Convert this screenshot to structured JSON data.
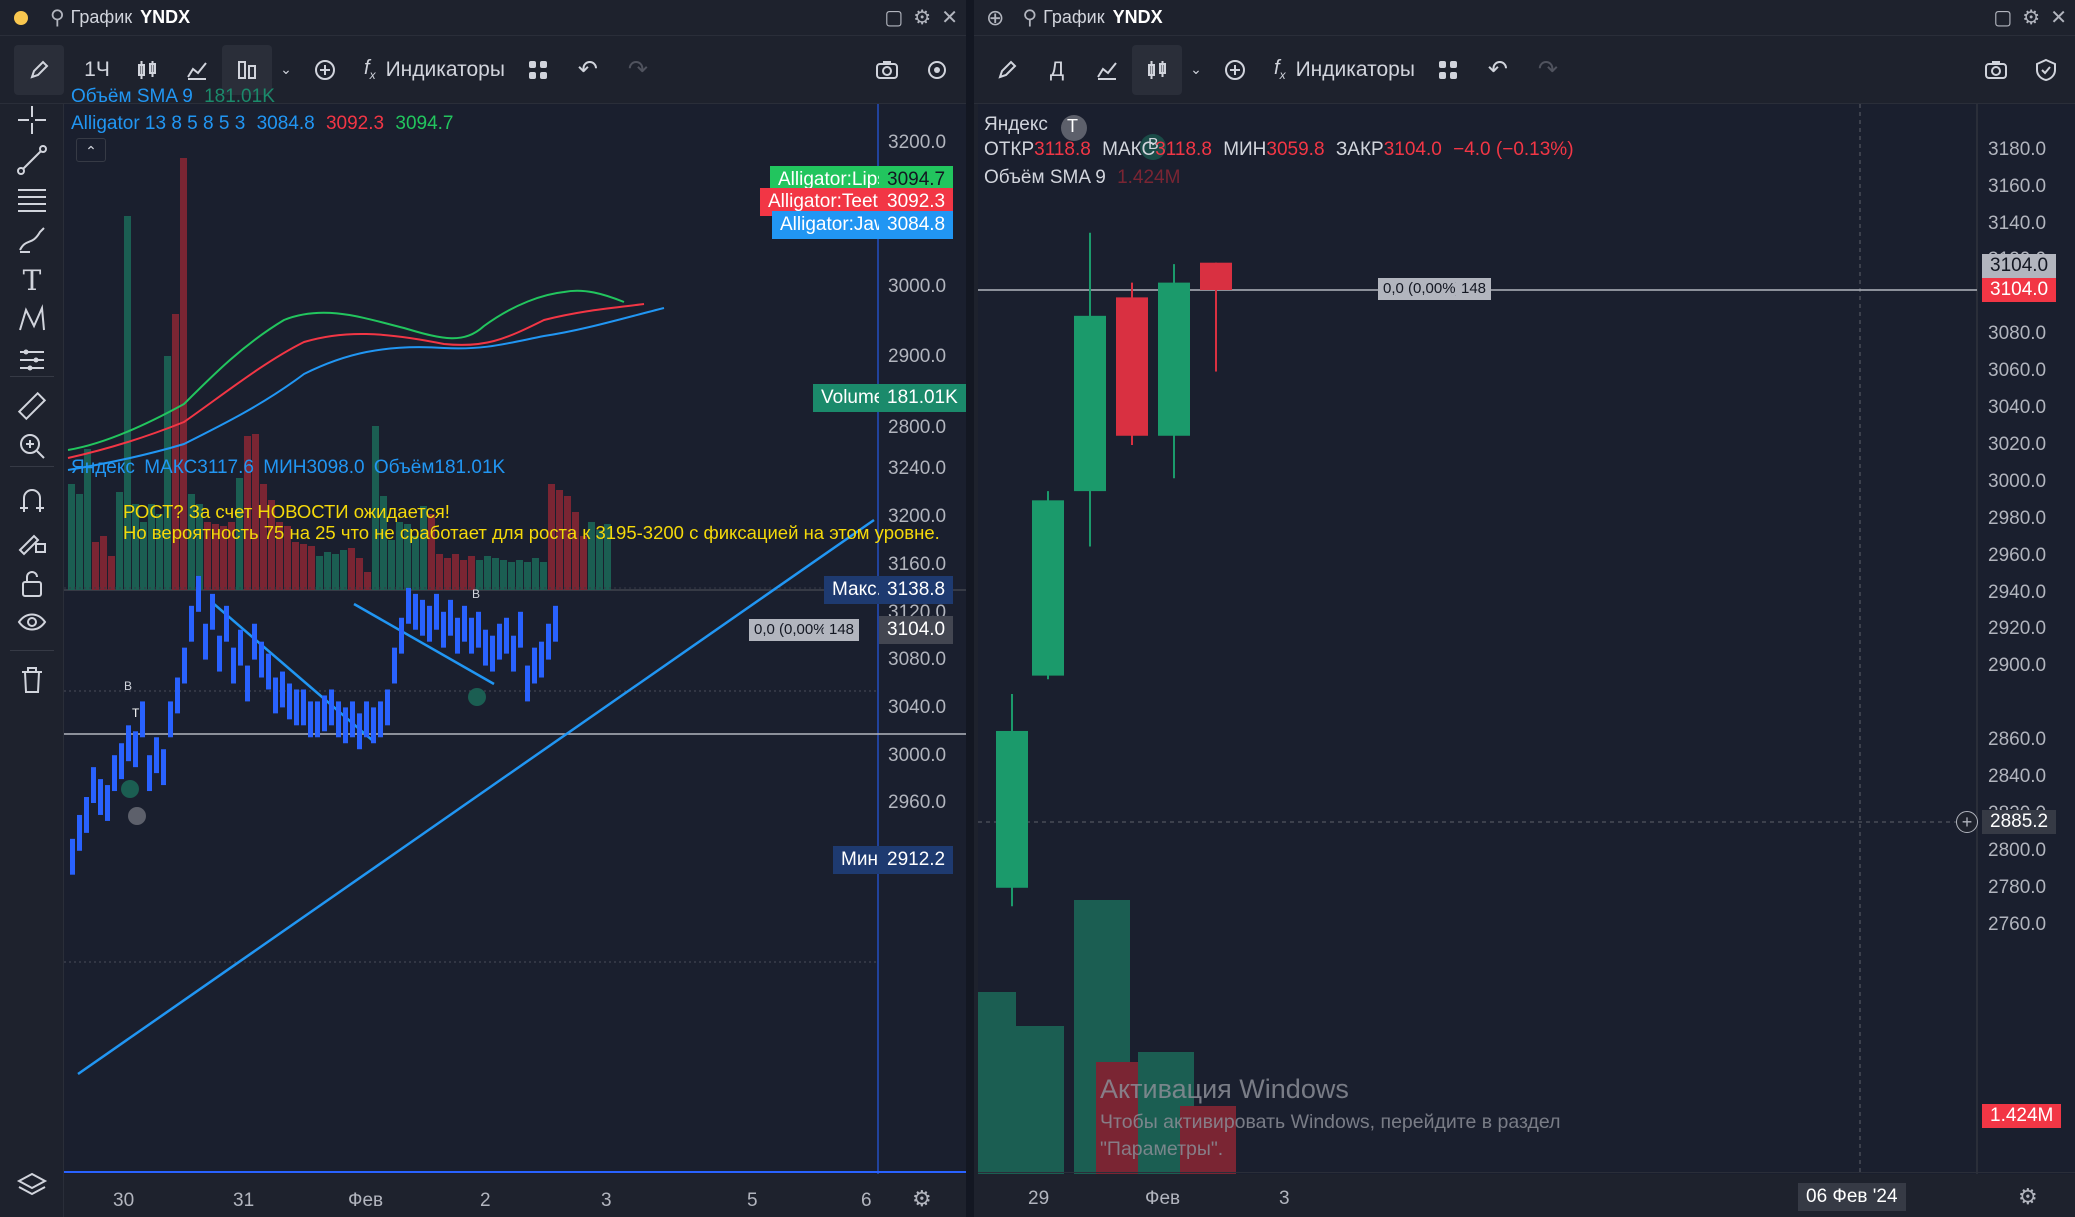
{
  "left_window": {
    "title": "График",
    "symbol": "YNDX",
    "toolbar": {
      "interval": "1Ч",
      "indicators": "Индикаторы"
    },
    "top_pane": {
      "legend_volume": "Объём SMA 9",
      "legend_volume_value": "181.01K",
      "legend_alligator": "Alligator 13 8 5 8 5 3",
      "alligator_jaw_value": "3084.8",
      "alligator_teeth_value": "3092.3",
      "alligator_lips_value": "3094.7",
      "price_labels": [
        "3200.0",
        "3000.0",
        "2900.0",
        "2800.0"
      ],
      "tags": {
        "lips_name": "Alligator:Lips",
        "lips_val": "3094.7",
        "teeth_name": "Alligator:Teeth",
        "teeth_val": "3092.3",
        "jaw_name": "Alligator:Jaw",
        "jaw_val": "3084.8",
        "volume_name": "Volume",
        "volume_val": "181.01K"
      }
    },
    "bottom_pane": {
      "legend_symbol": "Яндекс",
      "legend_max_label": "МАКС",
      "legend_max": "3117.6",
      "legend_min_label": "МИН",
      "legend_min": "3098.0",
      "legend_vol_label": "Объём",
      "legend_vol": "181.01K",
      "annotation_line1": "РОСТ? За счет НОВОСТИ ожидается!",
      "annotation_line2": "Но вероятность 75 на 25 что не сработает для роста к 3195-3200 с фиксацией на этом уровне.",
      "price_labels": [
        "3240.0",
        "3200.0",
        "3160.0",
        "3120.0",
        "3080.0",
        "3040.0",
        "3000.0",
        "2960.0"
      ],
      "max_tag_label": "Макс.",
      "max_tag_val": "3138.8",
      "min_tag_label": "Мин.",
      "min_tag_val": "2912.2",
      "current_price": "3104.0",
      "ruler_text": "0,0 (0,00%)",
      "ruler_count": "148",
      "marker_b": "B",
      "marker_t": "T"
    },
    "time_labels": [
      "30",
      "31",
      "Фев",
      "2",
      "3",
      "5",
      "6"
    ]
  },
  "right_window": {
    "title": "График",
    "symbol": "YNDX",
    "toolbar": {
      "interval": "Д",
      "indicators": "Индикаторы"
    },
    "legend_symbol": "Яндекс",
    "ohlc": {
      "open_label": "ОТКР",
      "open": "3118.8",
      "high_label": "МАКС",
      "high": "3118.8",
      "low_label": "МИН",
      "low": "3059.8",
      "close_label": "ЗАКР",
      "close": "3104.0",
      "change": "−4.0 (−0.13%)"
    },
    "legend_volume": "Объём SMA 9",
    "legend_volume_value": "1.424M",
    "price_labels": [
      "3180.0",
      "3160.0",
      "3140.0",
      "3120.0",
      "3080.0",
      "3060.0",
      "3040.0",
      "3020.0",
      "3000.0",
      "2980.0",
      "2960.0",
      "2940.0",
      "2920.0",
      "2900.0",
      "2860.0",
      "2840.0",
      "2820.0",
      "2800.0",
      "2780.0",
      "2760.0"
    ],
    "price_tag_top": "3104.0",
    "price_tag_current": "3104.0",
    "crosshair_price": "2885.2",
    "volume_tag": "1.424M",
    "ruler_text": "0,0 (0,00%)",
    "ruler_count": "148",
    "marker_t": "T",
    "marker_b": "B",
    "time_labels": [
      "29",
      "Фев",
      "3"
    ],
    "time_highlight": "06 Фев '24"
  },
  "watermark": {
    "title": "Активация Windows",
    "text1": "Чтобы активировать Windows, перейдите в раздел",
    "text2": "\"Параметры\"."
  },
  "colors": {
    "bg": "#131722",
    "panel": "#1e222d",
    "up": "#26a69a",
    "green": "#089981",
    "red": "#f23645",
    "blue_bars": "#2962ff",
    "alligator_lips": "#22c55e",
    "alligator_teeth": "#f23645",
    "alligator_jaw": "#2196f3",
    "annotation": "#f5d90a"
  }
}
